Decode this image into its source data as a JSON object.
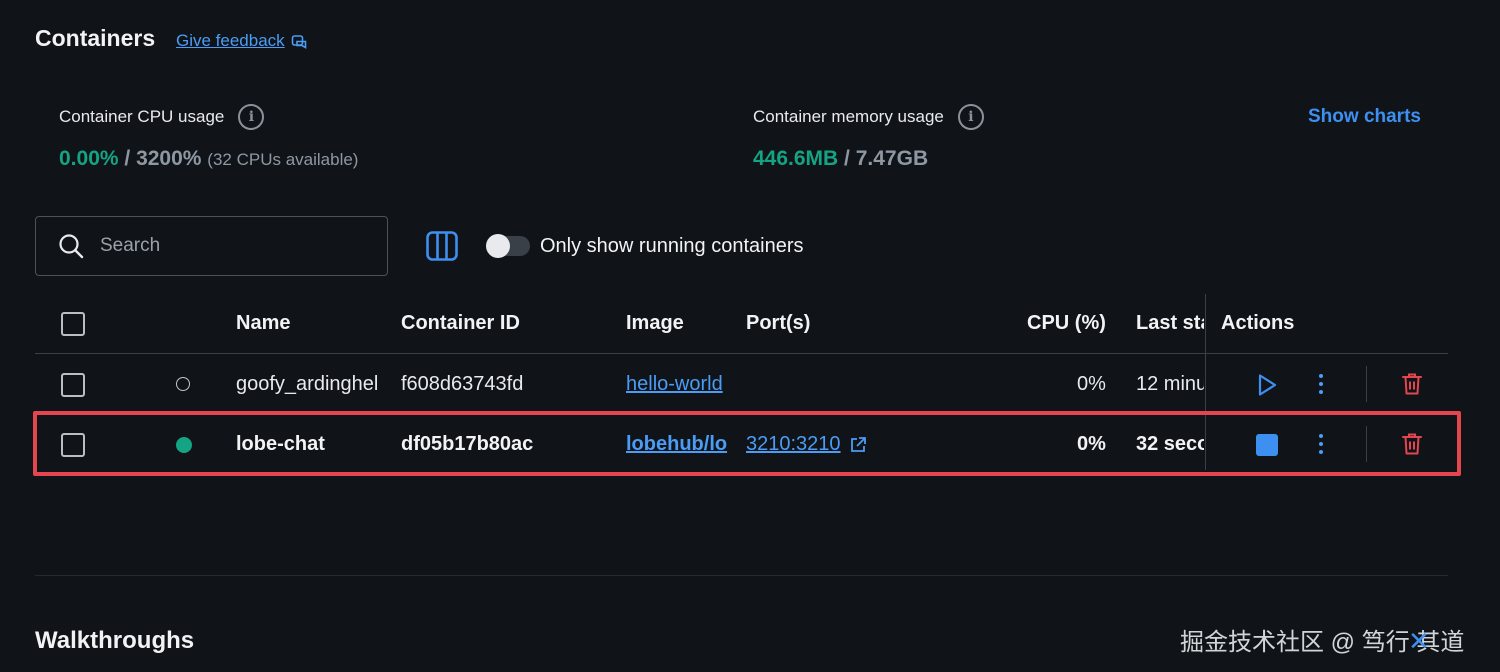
{
  "header": {
    "title": "Containers",
    "feedback_label": "Give feedback"
  },
  "stats": {
    "cpu": {
      "label": "Container CPU usage",
      "value_used": "0.00%",
      "separator": " / ",
      "value_total": "3200%",
      "note": "(32 CPUs available)"
    },
    "memory": {
      "label": "Container memory usage",
      "value_used": "446.6MB",
      "separator": " / ",
      "value_total": "7.47GB"
    },
    "show_charts_label": "Show charts"
  },
  "toolbar": {
    "search_placeholder": "Search",
    "running_only_label": "Only show running containers",
    "running_only_enabled": false
  },
  "table": {
    "columns": {
      "name": "Name",
      "container_id": "Container ID",
      "image": "Image",
      "ports": "Port(s)",
      "cpu": "CPU (%)",
      "last_started": "Last sta",
      "actions": "Actions"
    },
    "rows": [
      {
        "status": "stopped",
        "name": "goofy_ardinghel",
        "container_id": "f608d63743fd",
        "image": "hello-world",
        "ports": "",
        "cpu": "0%",
        "last_started": "12 minu",
        "primary_action": "start"
      },
      {
        "status": "running",
        "name": "lobe-chat",
        "container_id": "df05b17b80ac",
        "image": "lobehub/lo",
        "ports": "3210:3210",
        "cpu": "0%",
        "last_started": "32 seco",
        "primary_action": "stop"
      }
    ]
  },
  "sections": {
    "walkthroughs_title": "Walkthroughs"
  },
  "watermark": {
    "text": "掘金技术社区 @ 笃行  其道"
  },
  "colors": {
    "background": "#101418",
    "accent": "#3d8ff0",
    "running": "#14a383",
    "danger": "#e5454f"
  },
  "icons": {
    "feedback": "external-feedback-icon",
    "info": "info-icon",
    "search": "search-icon",
    "columns": "columns-icon",
    "start": "play-icon",
    "stop": "stop-icon",
    "more": "kebab-menu-icon",
    "delete": "trash-icon",
    "open_port": "external-link-icon"
  }
}
